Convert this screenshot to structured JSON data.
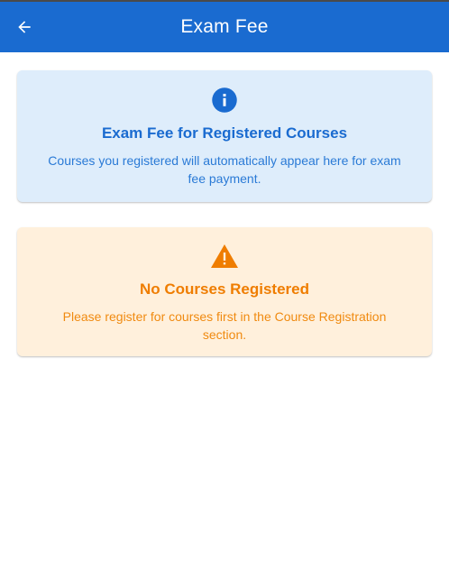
{
  "appbar": {
    "title": "Exam Fee",
    "back_icon": "arrow-back-icon",
    "background": "#1a6bd0"
  },
  "info_card": {
    "icon": "info-icon",
    "title": "Exam Fee for Registered Courses",
    "text": "Courses you registered will automatically appear here for exam fee payment.",
    "accent": "#1a6bd0",
    "background": "#deedfb"
  },
  "warning_card": {
    "icon": "warning-icon",
    "title": "No Courses Registered",
    "text": "Please register for courses first in the Course Registration section.",
    "accent": "#ef7d00",
    "background": "#fff0dc"
  }
}
